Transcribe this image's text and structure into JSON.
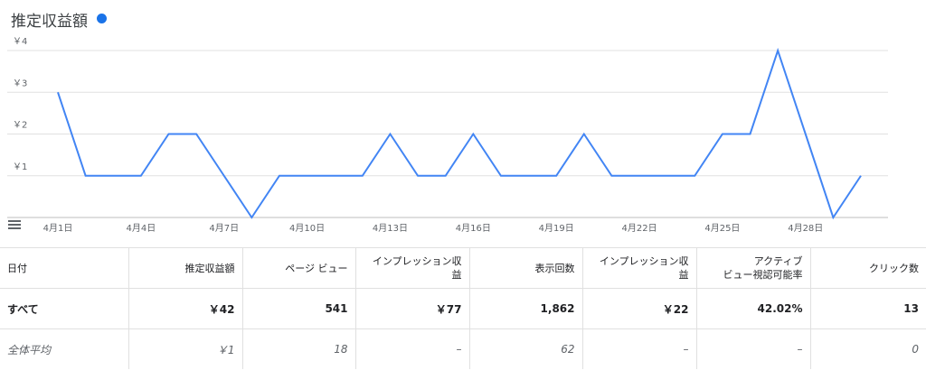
{
  "header": {
    "title": "推定収益額",
    "dot_color": "#1a73e8"
  },
  "chart_data": {
    "type": "line",
    "title": "推定収益額",
    "x": [
      "4月1日",
      "4月2日",
      "4月3日",
      "4月4日",
      "4月5日",
      "4月6日",
      "4月7日",
      "4月8日",
      "4月9日",
      "4月10日",
      "4月11日",
      "4月12日",
      "4月13日",
      "4月14日",
      "4月15日",
      "4月16日",
      "4月17日",
      "4月18日",
      "4月19日",
      "4月20日",
      "4月21日",
      "4月22日",
      "4月23日",
      "4月24日",
      "4月25日",
      "4月26日",
      "4月27日",
      "4月28日",
      "4月29日",
      "4月30日"
    ],
    "xticks": [
      "4月1日",
      "4月4日",
      "4月7日",
      "4月10日",
      "4月13日",
      "4月16日",
      "4月19日",
      "4月22日",
      "4月25日",
      "4月28日"
    ],
    "series": [
      {
        "values": [
          3,
          1,
          1,
          1,
          2,
          2,
          1,
          0,
          1,
          1,
          1,
          1,
          2,
          1,
          1,
          2,
          1,
          1,
          1,
          2,
          1,
          1,
          1,
          1,
          2,
          2,
          4,
          2,
          0,
          1
        ]
      }
    ],
    "yticks": [
      "￥1",
      "￥2",
      "￥3",
      "￥4"
    ],
    "ylim": [
      0,
      4
    ],
    "line_color": "#4285f4",
    "grid": true
  },
  "table": {
    "headers": [
      [
        "日付"
      ],
      [
        "推定収益額"
      ],
      [
        "ページ ビュー"
      ],
      [
        "インプレッション収益"
      ],
      [
        "表示回数"
      ],
      [
        "インプレッション収益"
      ],
      [
        "アクティブ",
        "ビュー視認可能率"
      ],
      [
        "クリック数"
      ]
    ],
    "rows": [
      {
        "kind": "total",
        "cells": [
          "すべて",
          "￥42",
          "541",
          "￥77",
          "1,862",
          "￥22",
          "42.02%",
          "13"
        ]
      },
      {
        "kind": "avg",
        "cells": [
          "全体平均",
          "￥1",
          "18",
          "–",
          "62",
          "–",
          "–",
          "0"
        ]
      }
    ]
  }
}
